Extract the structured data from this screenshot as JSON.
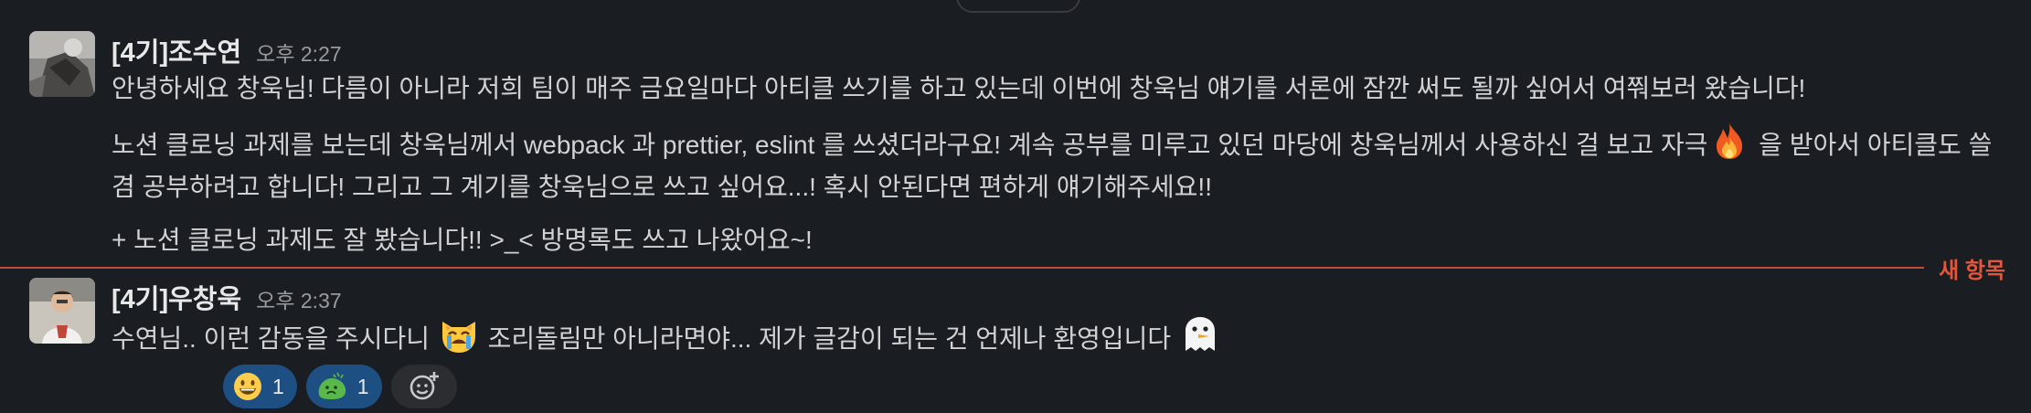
{
  "messages": [
    {
      "author": "[4기]조수연",
      "time": "오후 2:27",
      "paragraphs": {
        "p1": "안녕하세요 창욱님! 다름이 아니라 저희 팀이 매주 금요일마다 아티클 쓰기를 하고 있는데 이번에 창욱님 얘기를 서론에 잠깐 써도 될까 싶어서 여쭤보러 왔습니다!",
        "p2a": "노션 클로닝 과제를 보는데 창욱님께서 webpack 과 prettier, eslint 를 쓰셨더라구요! 계속 공부를 미루고 있던 마당에 창욱님께서 사용하신 걸 보고 자극",
        "p2b": " 을 받아서 아티클도 쓸 겸 공부하려고 합니다! 그리고 그 계기를 창욱님으로 쓰고 싶어요...! 혹시 안된다면 편하게 얘기해주세요!!",
        "p3": "+ 노션 클로닝 과제도 잘 봤습니다!! >_< 방명록도 쓰고 나왔어요~!"
      },
      "emojis": [
        "fire-emoji"
      ]
    },
    {
      "author": "[4기]우창욱",
      "time": "오후 2:37",
      "paragraphs": {
        "p1a": "수연님.. 이런 감동을 주시다니 ",
        "p1b": " 조리돌림만 아니라면야... 제가 글감이 되는 건 언제나 환영입니다 "
      },
      "emojis": [
        "crying-cat-emoji",
        "ghost-emoji"
      ],
      "reactions": [
        {
          "icon": "grinning-face-icon",
          "count": "1"
        },
        {
          "icon": "green-blob-icon",
          "count": "1"
        }
      ]
    }
  ],
  "divider": {
    "label": "새 항목"
  },
  "colors": {
    "background": "#1a1d21",
    "divider": "#c0503c",
    "divider_label": "#e0573c",
    "reaction_bg": "#1d4f83"
  }
}
